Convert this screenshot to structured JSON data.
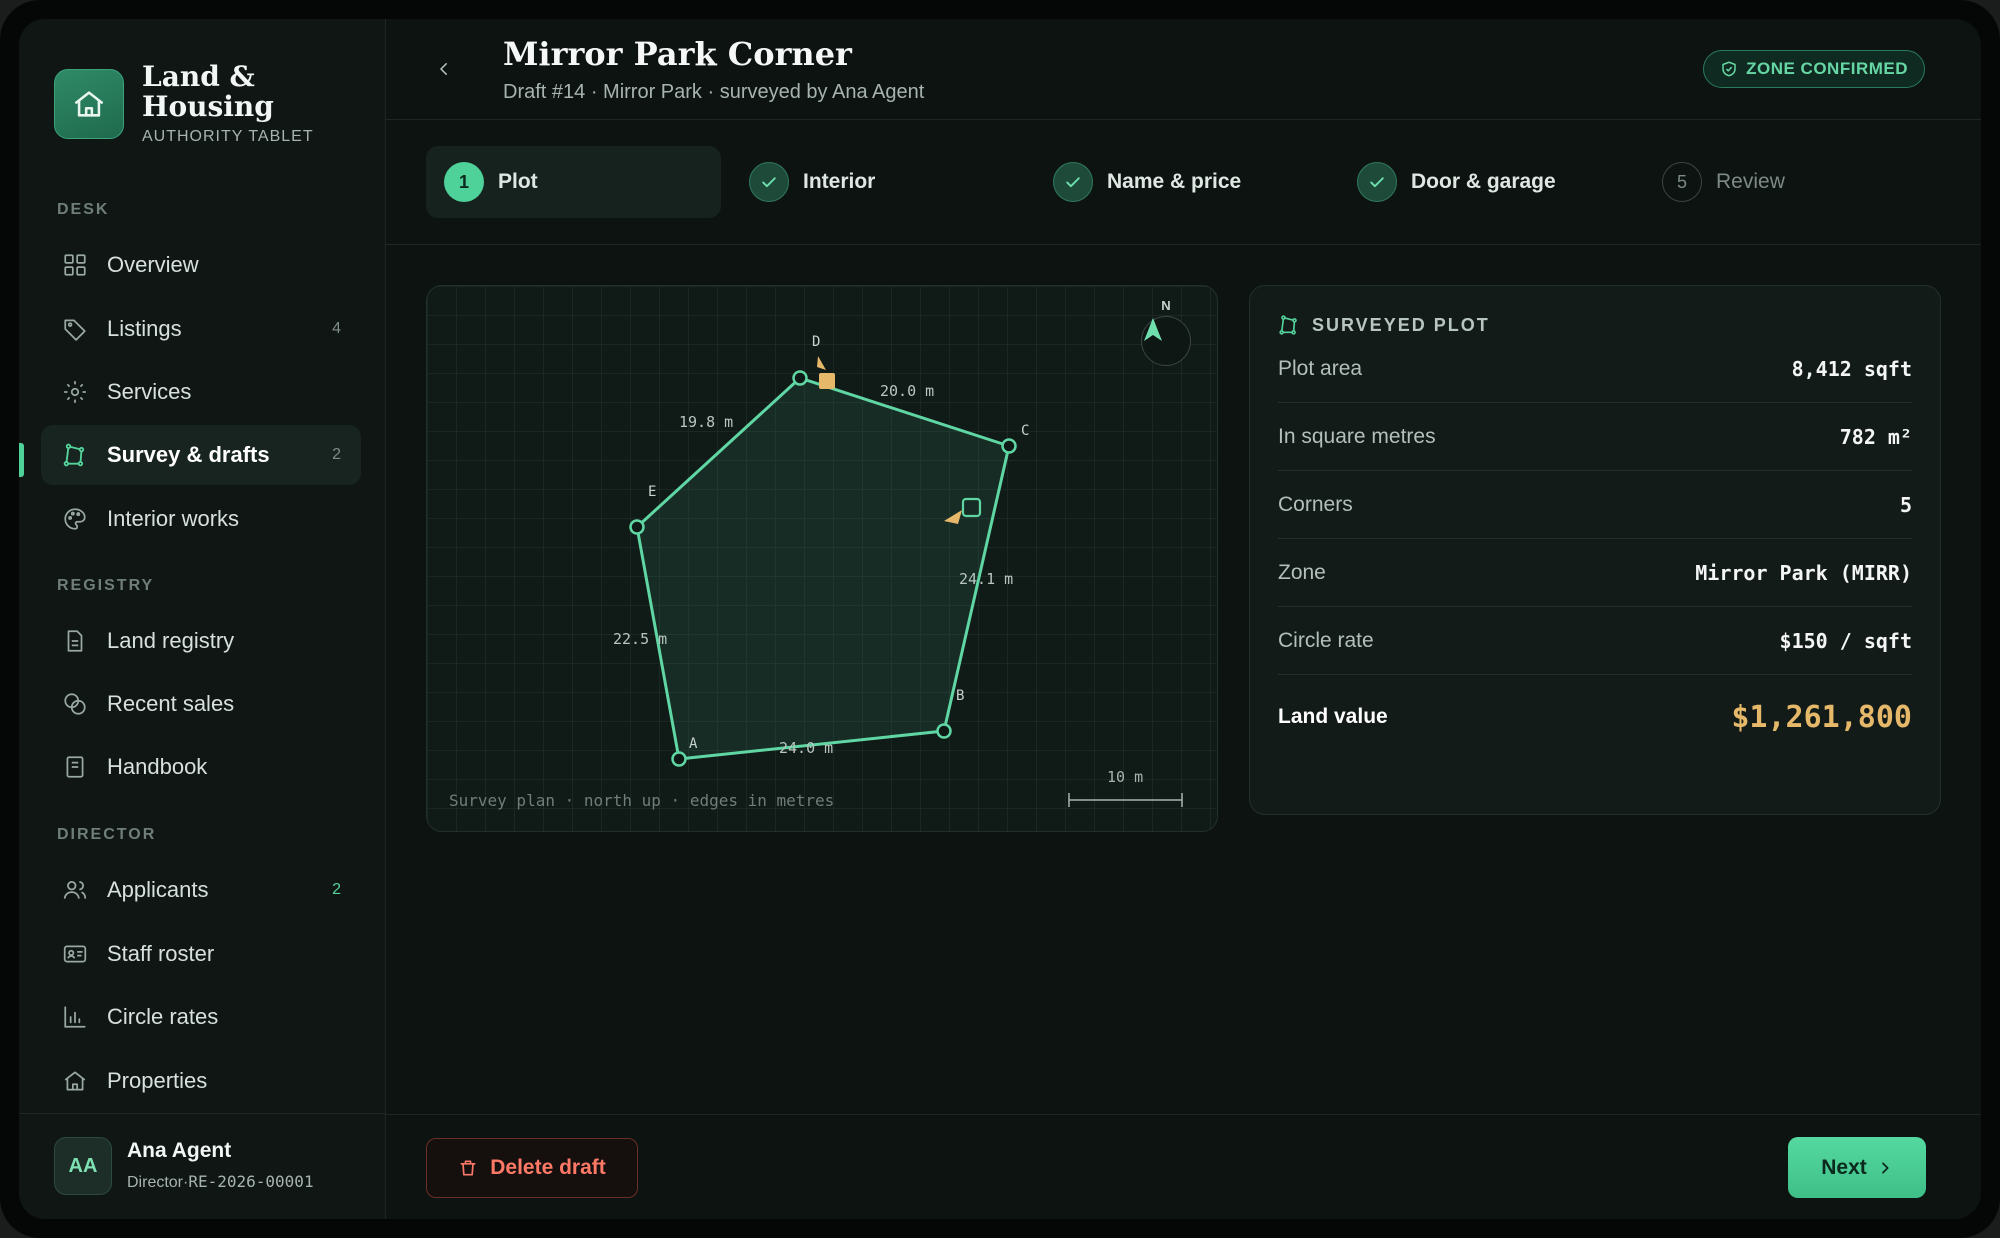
{
  "brand": {
    "name": "Land & Housing",
    "subtitle": "AUTHORITY TABLET"
  },
  "sidebar": {
    "sections": [
      {
        "label": "DESK"
      },
      {
        "label": "REGISTRY"
      },
      {
        "label": "DIRECTOR"
      }
    ],
    "items": [
      {
        "label": "Overview",
        "count": ""
      },
      {
        "label": "Listings",
        "count": "4"
      },
      {
        "label": "Services",
        "count": ""
      },
      {
        "label": "Survey & drafts",
        "count": "2",
        "active": true
      },
      {
        "label": "Interior works",
        "count": ""
      },
      {
        "label": "Land registry",
        "count": ""
      },
      {
        "label": "Recent sales",
        "count": ""
      },
      {
        "label": "Handbook",
        "count": ""
      },
      {
        "label": "Applicants",
        "count": "2"
      },
      {
        "label": "Staff roster",
        "count": ""
      },
      {
        "label": "Circle rates",
        "count": ""
      },
      {
        "label": "Properties",
        "count": ""
      }
    ]
  },
  "user": {
    "initials": "AA",
    "name": "Ana Agent",
    "role": "Director",
    "id": "RE-2026-00001",
    "separator": "·"
  },
  "header": {
    "title": "Mirror Park Corner",
    "subtitle": "Draft #14 · Mirror Park · surveyed by Ana Agent",
    "badge": "ZONE CONFIRMED"
  },
  "steps": [
    {
      "num": "1",
      "label": "Plot",
      "state": "active"
    },
    {
      "num": "2",
      "label": "Interior",
      "state": "done"
    },
    {
      "num": "3",
      "label": "Name & price",
      "state": "done"
    },
    {
      "num": "4",
      "label": "Door & garage",
      "state": "done"
    },
    {
      "num": "5",
      "label": "Review",
      "state": "idle"
    }
  ],
  "plan": {
    "caption": "Survey plan · north up · edges in metres",
    "scale_label": "10 m",
    "compass_label": "N",
    "corners": [
      "A",
      "B",
      "C",
      "D",
      "E"
    ],
    "edges": [
      "24.0 m",
      "24.1 m",
      "20.0 m",
      "19.8 m",
      "22.5 m"
    ]
  },
  "panel": {
    "title": "SURVEYED PLOT",
    "rows": [
      {
        "key": "Plot area",
        "value": "8,412 sqft"
      },
      {
        "key": "In square metres",
        "value": "782 m²"
      },
      {
        "key": "Corners",
        "value": "5"
      },
      {
        "key": "Zone",
        "value": "Mirror Park (MIRR)"
      },
      {
        "key": "Circle rate",
        "value": "$150 / sqft"
      },
      {
        "key": "Land value",
        "value": "$1,261,800"
      }
    ]
  },
  "footer": {
    "delete_label": "Delete draft",
    "next_label": "Next"
  },
  "colors": {
    "accent": "#4fd29a",
    "danger": "#ff7a66",
    "value_gold": "#e6b86a",
    "background": "#0d1311"
  }
}
